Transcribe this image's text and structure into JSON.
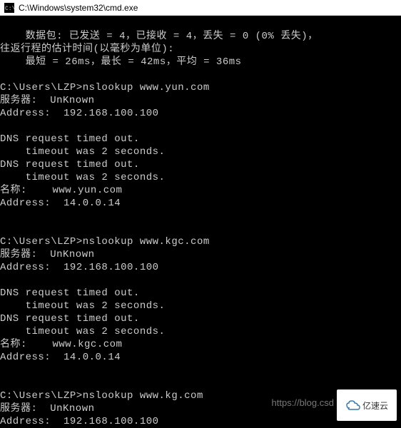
{
  "window": {
    "title": "C:\\Windows\\system32\\cmd.exe"
  },
  "prompt_path": "C:\\Users\\LZP>",
  "ping_summary": {
    "packets_line": "    数据包: 已发送 = 4，已接收 = 4，丢失 = 0 (0% 丢失)，",
    "rtt_header": "往返行程的估计时间(以毫秒为单位):",
    "rtt_line": "    最短 = 26ms，最长 = 42ms，平均 = 36ms"
  },
  "blank": "",
  "lookups": [
    {
      "cmd": "nslookup www.yun.com",
      "server_label": "服务器:  UnKnown",
      "server_addr": "Address:  192.168.100.100",
      "timeouts": [
        "DNS request timed out.",
        "    timeout was 2 seconds.",
        "DNS request timed out.",
        "    timeout was 2 seconds."
      ],
      "name_line": "名称:    www.yun.com",
      "addr_line": "Address:  14.0.0.14"
    },
    {
      "cmd": "nslookup www.kgc.com",
      "server_label": "服务器:  UnKnown",
      "server_addr": "Address:  192.168.100.100",
      "timeouts": [
        "DNS request timed out.",
        "    timeout was 2 seconds.",
        "DNS request timed out.",
        "    timeout was 2 seconds."
      ],
      "name_line": "名称:    www.kgc.com",
      "addr_line": "Address:  14.0.0.14"
    },
    {
      "cmd": "nslookup www.kg.com",
      "server_label": "服务器:  UnKnown",
      "server_addr": "Address:  192.168.100.100",
      "timeouts": [],
      "name_line": "",
      "addr_line": ""
    }
  ],
  "watermark_text": "https://blog.csd",
  "logo_text": "亿速云"
}
